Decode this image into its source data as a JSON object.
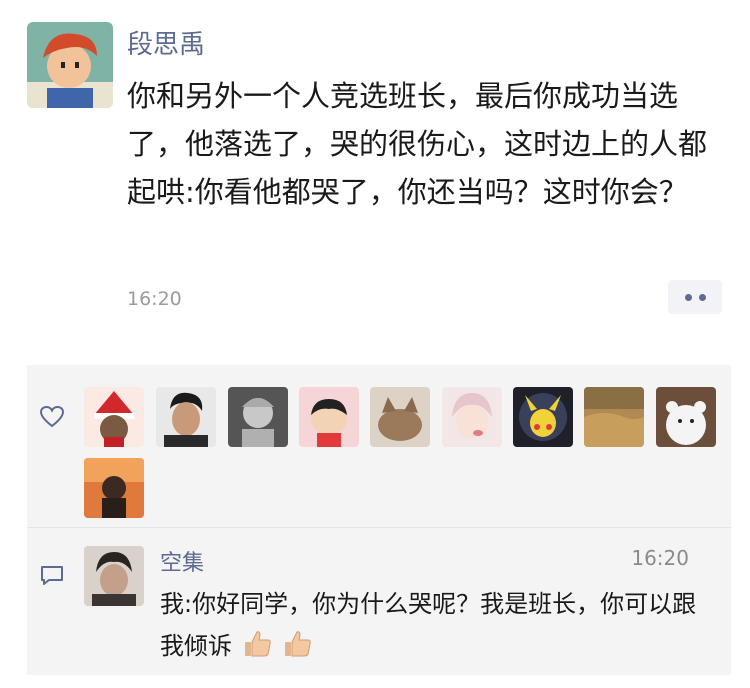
{
  "post": {
    "author": "段思禹",
    "text": "你和另外一个人竞选班长，最后你成功当选了，他落选了，哭的很伤心，这时边上的人都起哄:你看他都哭了，你还当吗？这时你会？",
    "time": "16:20",
    "avatar_icon": "cartoon-boy-avatar"
  },
  "likes": {
    "icon": "heart-outline-icon",
    "avatars": [
      "santa-avatar",
      "man-portrait-avatar",
      "statue-avatar",
      "crayon-shin-chan-avatar",
      "cat-avatar",
      "anime-girl-avatar",
      "pikachu-avatar",
      "landscape-avatar",
      "polar-bear-avatar",
      "sunset-figure-avatar"
    ]
  },
  "comment": {
    "icon": "comment-icon",
    "author": "空集",
    "time": "16:20",
    "text": "我:你好同学，你为什么哭呢？我是班长，你可以跟我倾诉",
    "emoji": [
      "thumbs-up-emoji",
      "thumbs-up-emoji"
    ]
  },
  "colors": {
    "name_blue": "#5b6b92",
    "panel_bg": "#f4f4f4",
    "text": "#1a1a1a",
    "meta": "#9a9a9a"
  }
}
